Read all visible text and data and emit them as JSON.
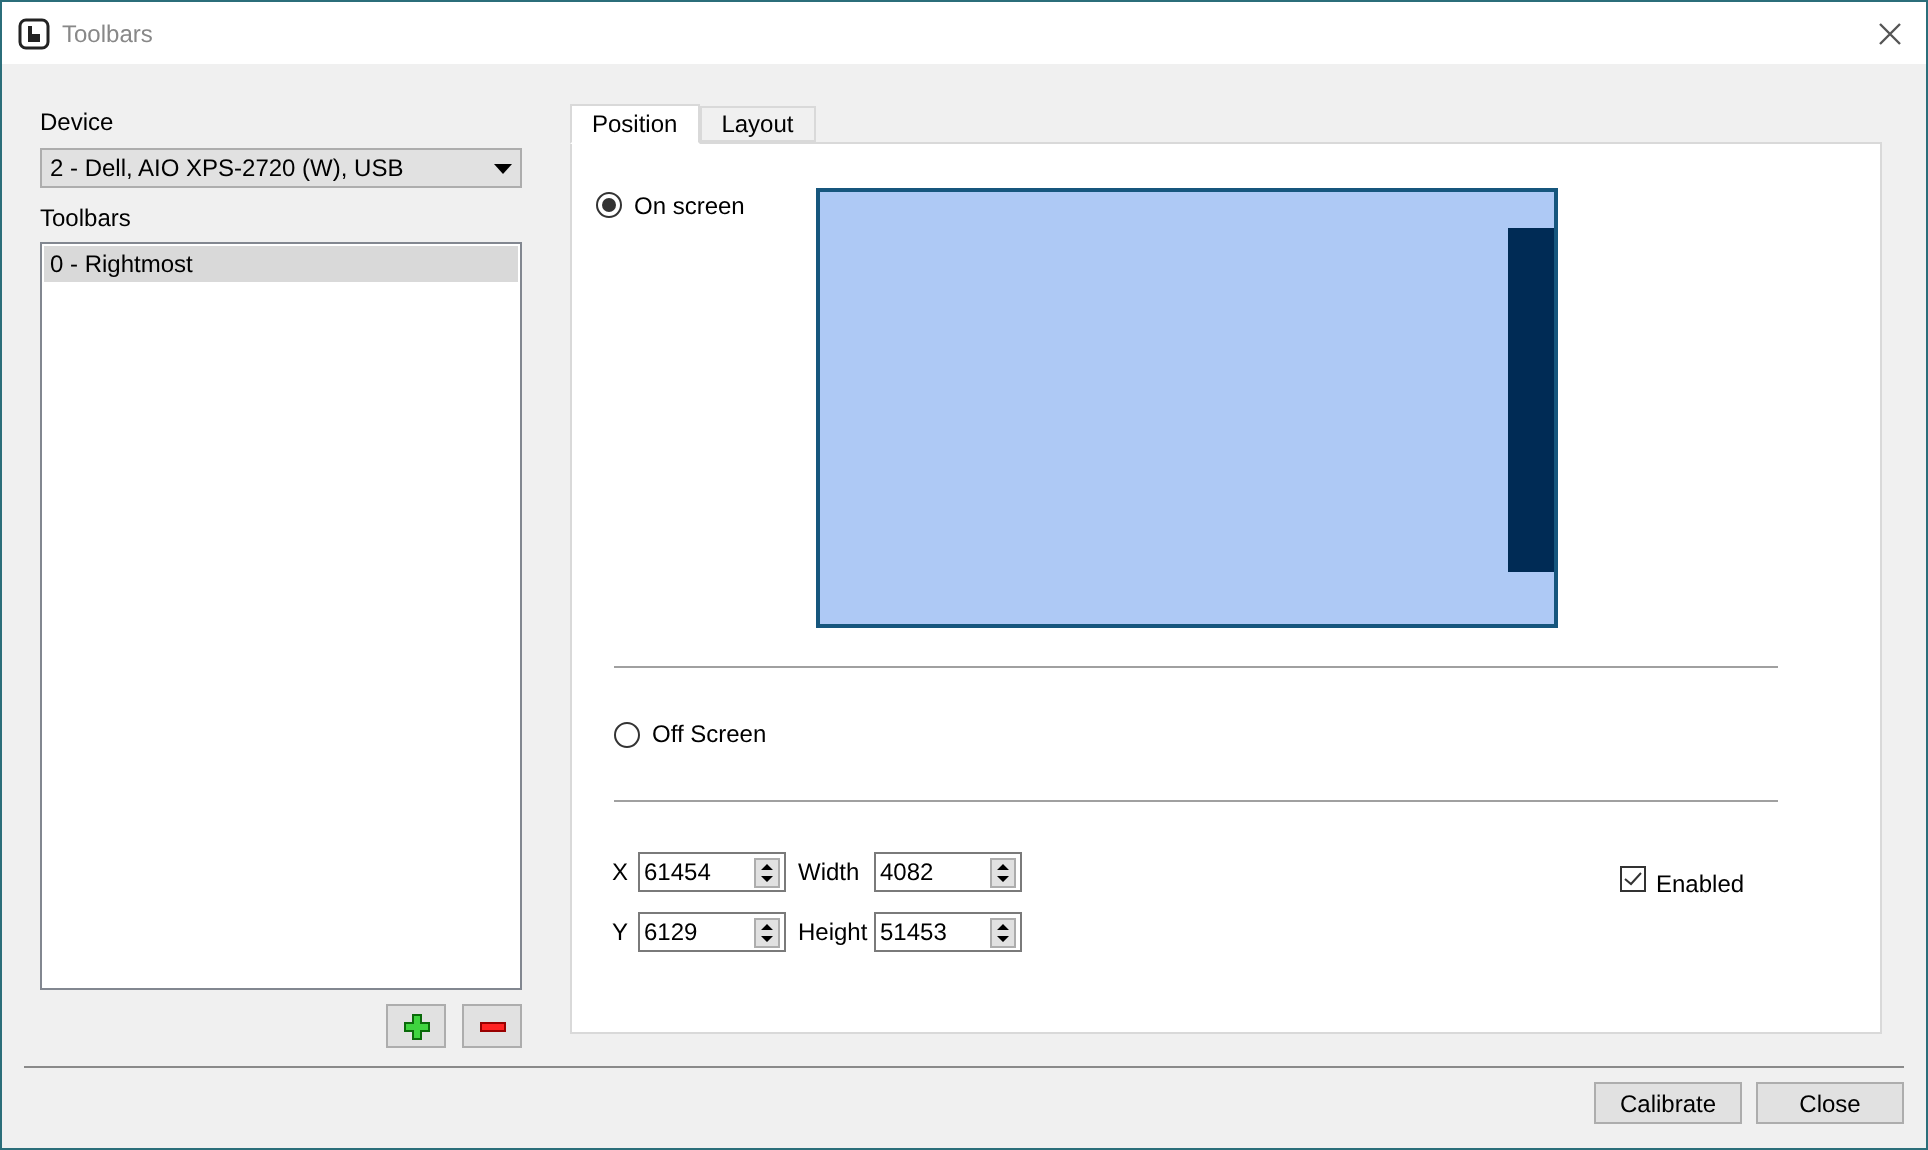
{
  "window": {
    "title": "Toolbars"
  },
  "device": {
    "label": "Device",
    "value": "2 - Dell, AIO XPS-2720 (W), USB"
  },
  "toolbars": {
    "label": "Toolbars",
    "items": [
      {
        "label": "0 - Rightmost",
        "selected": true
      }
    ]
  },
  "tabs": [
    {
      "label": "Position",
      "selected": true
    },
    {
      "label": "Layout",
      "selected": false
    }
  ],
  "placement": [
    {
      "label": "On screen",
      "selected": true
    },
    {
      "label": "Off Screen",
      "selected": false
    }
  ],
  "fields": [
    {
      "label": "X",
      "value": "61454"
    },
    {
      "label": "Width",
      "value": "4082"
    },
    {
      "label": "Y",
      "value": "6129"
    },
    {
      "label": "Height",
      "value": "51453"
    }
  ],
  "enabled": {
    "label": "Enabled",
    "checked": true
  },
  "buttons": [
    "Calibrate",
    "Close"
  ]
}
